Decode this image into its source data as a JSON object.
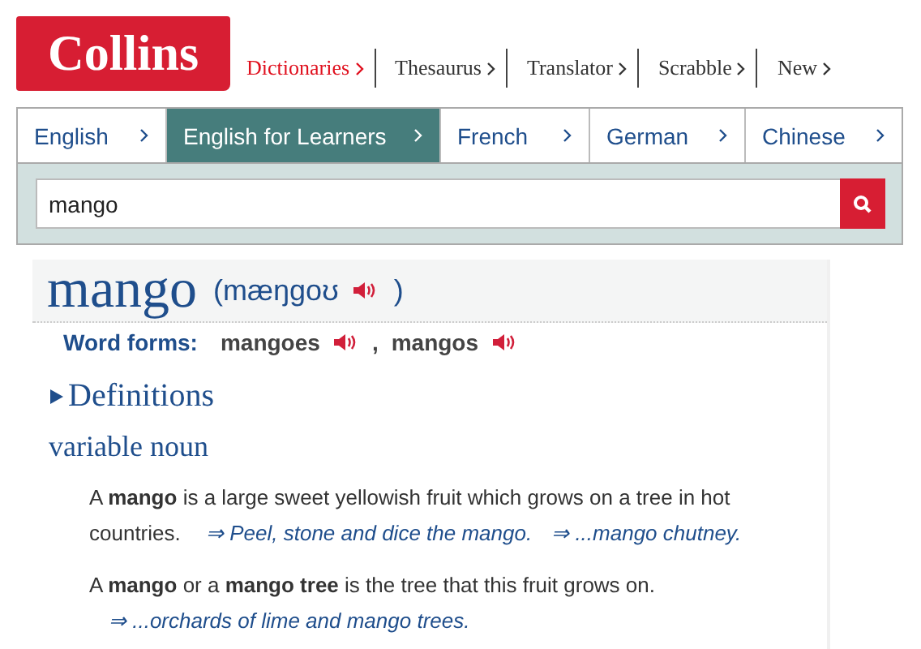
{
  "logo": "Collins",
  "nav": [
    {
      "label": "Dictionaries",
      "selected": true
    },
    {
      "label": "Thesaurus",
      "selected": false
    },
    {
      "label": "Translator",
      "selected": false
    },
    {
      "label": "Scrabble",
      "selected": false
    },
    {
      "label": "New",
      "selected": false
    }
  ],
  "tabs": [
    {
      "label": "English",
      "selected": false
    },
    {
      "label": "English for Learners",
      "selected": true
    },
    {
      "label": "French",
      "selected": false
    },
    {
      "label": "German",
      "selected": false
    },
    {
      "label": "Chinese",
      "selected": false
    }
  ],
  "search": {
    "value": "mango"
  },
  "entry": {
    "headword": "mango",
    "pronunciation_open": "(mæŋgoʊ",
    "pronunciation_close": ")",
    "word_forms_label": "Word forms:",
    "word_forms": [
      "mangoes",
      "mangos"
    ],
    "separator": ",",
    "section": "Definitions",
    "grammar": "variable noun",
    "senses": [
      {
        "text": "A **mango** is a large sweet yellowish fruit which grows on a tree in hot countries.",
        "examples": [
          "⇒ Peel, stone and dice the mango.",
          "⇒ ...mango chutney."
        ]
      },
      {
        "text": "A **mango** or a **mango tree** is the tree that this fruit grows on.",
        "examples": [
          "⇒ ...orchards of lime and mango trees."
        ]
      }
    ]
  }
}
